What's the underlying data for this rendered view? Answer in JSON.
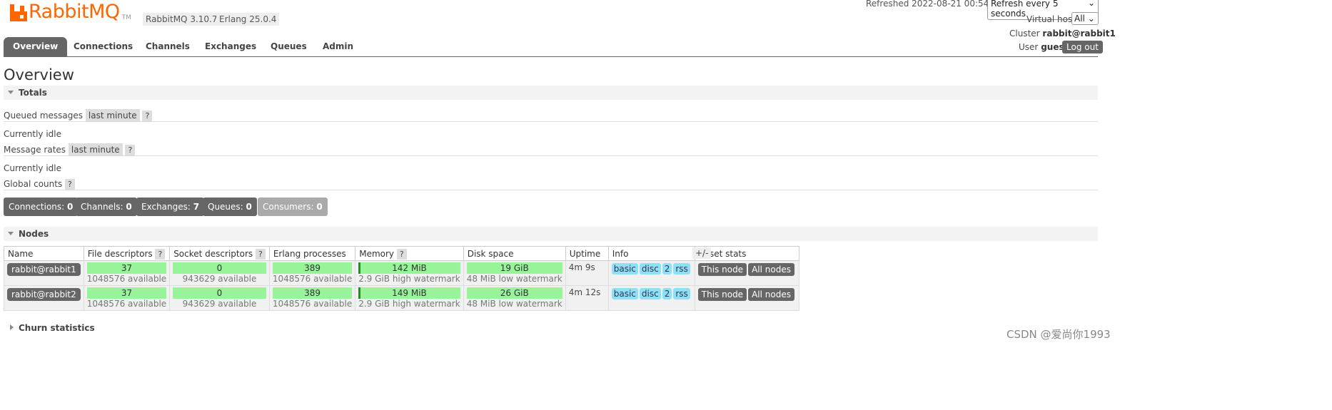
{
  "header": {
    "logo_text": "RabbitMQ",
    "tm": "TM",
    "rabbitmq_version": "RabbitMQ 3.10.7",
    "erlang_version": "Erlang 25.0.4",
    "refreshed": "Refreshed 2022-08-21 00:54:21",
    "refresh_option": "Refresh every 5 seconds",
    "virtual_host_label": "Virtual host",
    "virtual_host_value": "All",
    "cluster_label": "Cluster",
    "cluster_value": "rabbit@rabbit1",
    "user_label": "User",
    "user_value": "guest",
    "logout": "Log out"
  },
  "tabs": [
    "Overview",
    "Connections",
    "Channels",
    "Exchanges",
    "Queues",
    "Admin"
  ],
  "page_title": "Overview",
  "totals": {
    "title": "Totals",
    "queued_label": "Queued messages",
    "queued_range": "last minute",
    "queued_status": "Currently idle",
    "rates_label": "Message rates",
    "rates_range": "last minute",
    "rates_status": "Currently idle",
    "global_label": "Global counts",
    "help": "?"
  },
  "counts": [
    {
      "label": "Connections:",
      "value": "0"
    },
    {
      "label": "Channels:",
      "value": "0"
    },
    {
      "label": "Exchanges:",
      "value": "7"
    },
    {
      "label": "Queues:",
      "value": "0"
    },
    {
      "label": "Consumers:",
      "value": "0"
    }
  ],
  "nodes_section": {
    "title": "Nodes",
    "columns": [
      "Name",
      "File descriptors",
      "Socket descriptors",
      "Erlang processes",
      "Memory",
      "Disk space",
      "Uptime",
      "Info",
      "Reset stats"
    ],
    "plus_minus": "+/-",
    "rows": [
      {
        "name": "rabbit@rabbit1",
        "fd": "37",
        "fd_avail": "1048576 available",
        "sd": "0",
        "sd_avail": "943629 available",
        "ep": "389",
        "ep_avail": "1048576 available",
        "mem": "142 MiB",
        "mem_wm": "2.9 GiB high watermark",
        "disk": "19 GiB",
        "disk_wm": "48 MiB low watermark",
        "uptime": "4m 9s",
        "info": [
          "basic",
          "disc",
          "2",
          "rss"
        ],
        "this_node": "This node",
        "all_nodes": "All nodes"
      },
      {
        "name": "rabbit@rabbit2",
        "fd": "37",
        "fd_avail": "1048576 available",
        "sd": "0",
        "sd_avail": "943629 available",
        "ep": "389",
        "ep_avail": "1048576 available",
        "mem": "149 MiB",
        "mem_wm": "2.9 GiB high watermark",
        "disk": "26 GiB",
        "disk_wm": "48 MiB low watermark",
        "uptime": "4m 12s",
        "info": [
          "basic",
          "disc",
          "2",
          "rss"
        ],
        "this_node": "This node",
        "all_nodes": "All nodes"
      }
    ]
  },
  "churn": {
    "title": "Churn statistics"
  },
  "watermark": "CSDN @爱尚你1993",
  "colors": {
    "brand": "#ff6600",
    "bar": "#98f498",
    "tab_active": "#666666",
    "pill": "#8ee1f5"
  }
}
